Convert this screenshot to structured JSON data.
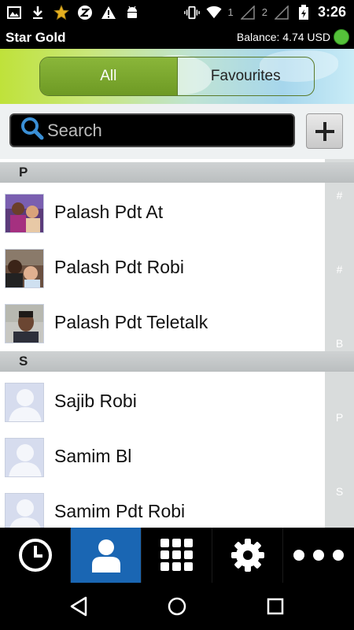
{
  "status_bar": {
    "time": "3:26",
    "sim1": "1",
    "sim2": "2",
    "icons_left": [
      "gallery-icon",
      "download-icon",
      "star-icon",
      "z-icon",
      "warning-icon",
      "android-icon"
    ],
    "icons_right": [
      "vibrate-icon",
      "wifi-icon",
      "signal-icon",
      "battery-icon"
    ]
  },
  "app": {
    "title": "Star Gold",
    "balance": "Balance: 4.74 USD",
    "status_color": "#55c23a"
  },
  "tabs": [
    {
      "label": "All",
      "active": true
    },
    {
      "label": "Favourites",
      "active": false
    }
  ],
  "search": {
    "placeholder": "Search"
  },
  "sections": [
    {
      "letter": "P"
    },
    {
      "letter": "S"
    }
  ],
  "contacts": [
    {
      "name": "Palash Pdt At",
      "avatar": "photo"
    },
    {
      "name": "Palash Pdt Robi",
      "avatar": "photo"
    },
    {
      "name": "Palash Pdt Teletalk",
      "avatar": "photo"
    },
    {
      "name": "Sajib Robi",
      "avatar": "placeholder"
    },
    {
      "name": "Samim Bl",
      "avatar": "placeholder"
    },
    {
      "name": "Samim Pdt Robi",
      "avatar": "placeholder"
    }
  ],
  "index_letters": [
    "#",
    "#",
    "B",
    "P",
    "S"
  ],
  "bottom_nav": [
    {
      "name": "recents",
      "icon": "clock-icon",
      "active": false
    },
    {
      "name": "contacts",
      "icon": "person-icon",
      "active": true
    },
    {
      "name": "dialpad",
      "icon": "dialpad-icon",
      "active": false
    },
    {
      "name": "settings",
      "icon": "gear-icon",
      "active": false
    },
    {
      "name": "more",
      "icon": "more-icon",
      "active": false
    }
  ],
  "colors": {
    "accent": "#1a66b3",
    "tab_active": "#7aa82e"
  }
}
